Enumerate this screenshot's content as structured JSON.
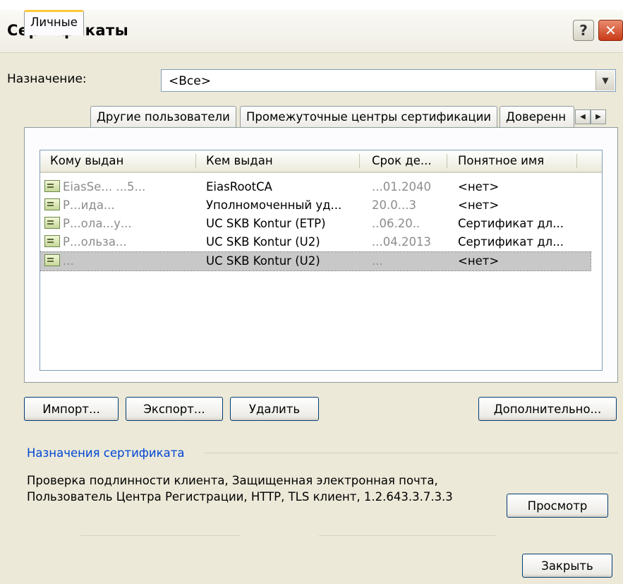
{
  "window": {
    "title": "Сертификаты",
    "help_label": "?",
    "close_label": "✕"
  },
  "purpose": {
    "label": "Назначение:",
    "value": "<Все>",
    "dropdown_icon": "chevron-down-icon"
  },
  "tabs": [
    {
      "label": "Личные",
      "active": true
    },
    {
      "label": "Другие пользователи",
      "active": false
    },
    {
      "label": "Промежуточные центры сертификации",
      "active": false
    },
    {
      "label": "Доверенн",
      "active": false
    }
  ],
  "tab_scroll": {
    "left": "◀",
    "right": "▶"
  },
  "list": {
    "columns": [
      "Кому выдан",
      "Кем выдан",
      "Срок де...",
      "Понятное имя"
    ],
    "rows": [
      {
        "issued_to": "EiasSe... ...5...",
        "issued_by": "EiasRootCA",
        "expires": "...01.2040",
        "friendly_name": "<нет>",
        "selected": false
      },
      {
        "issued_to": "Р...ида...",
        "issued_by": "Уполномоченный уд...",
        "expires": "20.0...3",
        "friendly_name": "<нет>",
        "selected": false
      },
      {
        "issued_to": "Р...ола...у...",
        "issued_by": "UC SKB Kontur (ETP)",
        "expires": "..06.20..",
        "friendly_name": "Сертификат дл...",
        "selected": false
      },
      {
        "issued_to": "Р...ольза...",
        "issued_by": "UC SKB Kontur (U2)",
        "expires": "...04.2013",
        "friendly_name": "Сертификат дл...",
        "selected": false
      },
      {
        "issued_to": "...",
        "issued_by": "UC SKB Kontur (U2)",
        "expires": "...",
        "friendly_name": "<нет>",
        "selected": true
      }
    ]
  },
  "buttons": {
    "import": "Импорт...",
    "export": "Экспорт...",
    "delete": "Удалить",
    "advanced": "Дополнительно...",
    "view": "Просмотр",
    "close": "Закрыть"
  },
  "cert_purposes": {
    "title": "Назначения сертификата",
    "line1": "Проверка подлинности клиента, Защищенная электронная почта,",
    "line2": "Пользователь Центра Регистрации, HTTP, TLS клиент, 1.2.643.3.7.3.3"
  }
}
